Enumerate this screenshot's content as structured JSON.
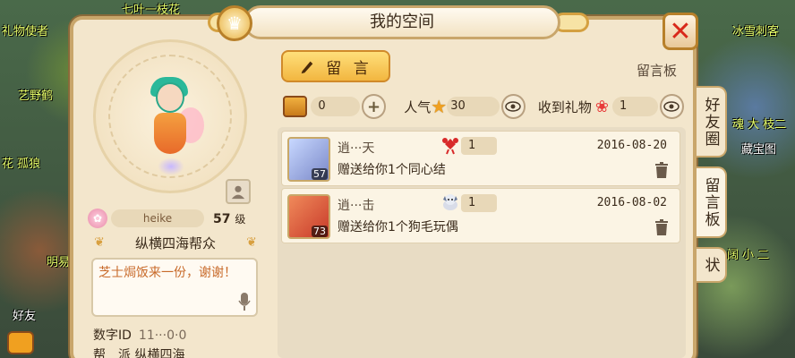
{
  "background": {
    "labels": [
      "七叶一枝花",
      "礼物使者",
      "冰雪刺客",
      "艺野鹤",
      "花 孤狼",
      "明易",
      "魂 大 枝二",
      "藏宝图",
      "阔 小 二",
      "好友"
    ]
  },
  "header": {
    "title": "我的空间"
  },
  "profile": {
    "name": "heike",
    "level": "57",
    "level_suffix": "级",
    "guild": "纵横四海帮众",
    "signature": "芝士焗饭来一份，谢谢！",
    "id_label": "数字ID",
    "id_value": "11···0·0",
    "sect_label": "帮　派",
    "sect_value": "纵横四海"
  },
  "toolbar": {
    "message_button": "留 言",
    "board_label": "留言板"
  },
  "stats": {
    "chest_count": "0",
    "popularity_label": "人气",
    "popularity_value": "30",
    "gifts_label": "收到礼物",
    "gifts_value": "1"
  },
  "messages": [
    {
      "sender": "逍···天",
      "avatar_level": "57",
      "gift_count": "1",
      "date": "2016-08-20",
      "text": "赠送给你1个同心结"
    },
    {
      "sender": "逍···击",
      "avatar_level": "73",
      "gift_count": "1",
      "date": "2016-08-02",
      "text": "赠送给你1个狗毛玩偶"
    }
  ],
  "side_tabs": [
    "好友圈",
    "留言板",
    "状"
  ],
  "bottom_left": {
    "friends_label": "好友"
  }
}
